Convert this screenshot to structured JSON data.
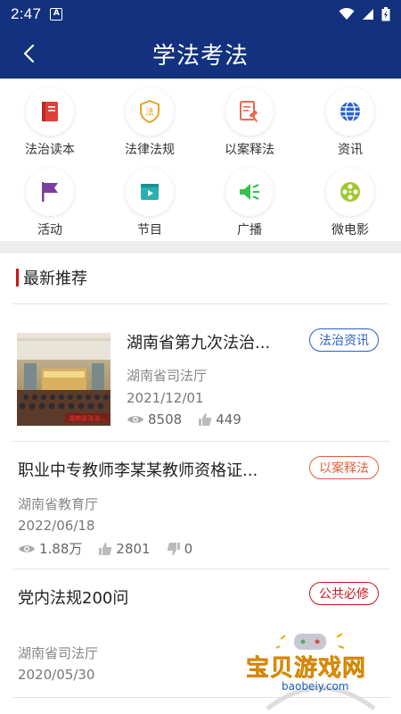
{
  "status_bar": {
    "time": "2:47",
    "notif_icon": "A"
  },
  "header": {
    "title": "学法考法"
  },
  "categories": [
    {
      "label": "法治读本",
      "icon": "book-icon",
      "color": "#e0403a"
    },
    {
      "label": "法律法规",
      "icon": "law-shield-icon",
      "color": "#f0a020"
    },
    {
      "label": "以案释法",
      "icon": "gavel-document-icon",
      "color": "#e86a4a"
    },
    {
      "label": "资讯",
      "icon": "globe-icon",
      "color": "#2a62c8"
    },
    {
      "label": "活动",
      "icon": "flag-icon",
      "color": "#7a3fa0"
    },
    {
      "label": "节目",
      "icon": "tv-play-icon",
      "color": "#2ab0b0"
    },
    {
      "label": "广播",
      "icon": "broadcast-icon",
      "color": "#3ac050"
    },
    {
      "label": "微电影",
      "icon": "film-reel-icon",
      "color": "#a0c830"
    }
  ],
  "section": {
    "title": "最新推荐"
  },
  "items": [
    {
      "title": "湖南省第九次法治...",
      "source": "湖南省司法厅",
      "date": "2021/12/01",
      "views": "8508",
      "likes": "449",
      "tag": "法治资讯",
      "tag_color": "#2a5fc8",
      "thumb_caption": "湖南省法治..."
    },
    {
      "title": "职业中专教师李某某教师资格证...",
      "source": "湖南省教育厅",
      "date": "2022/06/18",
      "views": "1.88万",
      "likes": "2801",
      "dislikes": "0",
      "tag": "以案释法",
      "tag_color": "#e2603c"
    },
    {
      "title": "党内法规200问",
      "source": "湖南省司法厅",
      "date": "2020/05/30",
      "tag": "公共必修",
      "tag_color": "#c8161d"
    }
  ],
  "watermark": {
    "text": "宝贝游戏网",
    "url": "baobeiy.com"
  }
}
